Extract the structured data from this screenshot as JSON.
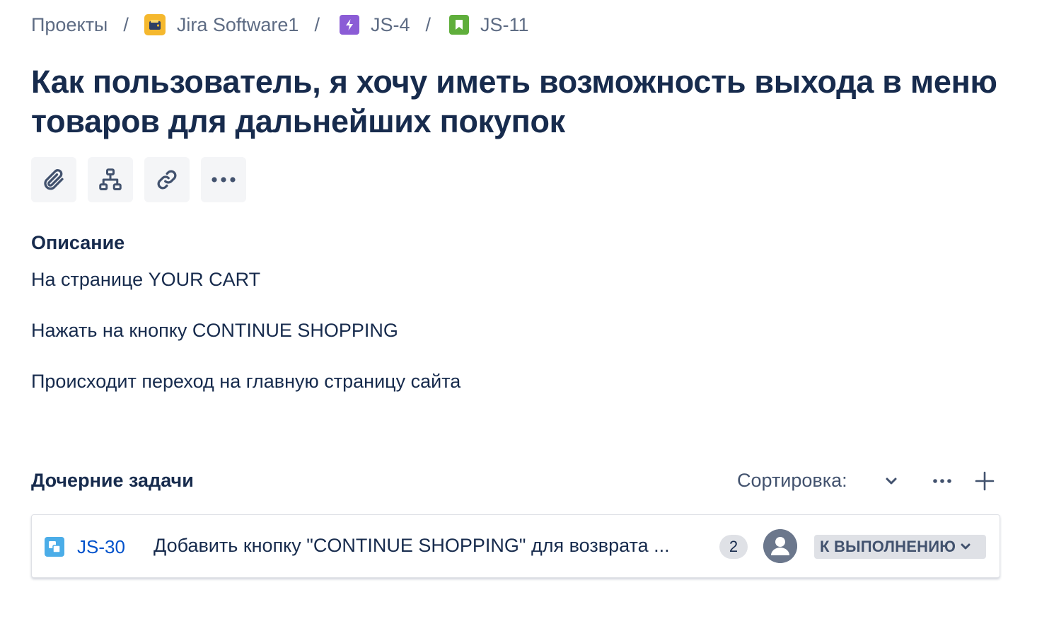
{
  "breadcrumbs": {
    "projects": "Проекты",
    "project": "Jira Software1",
    "epic": "JS-4",
    "story": "JS-11",
    "separator": "/"
  },
  "issue": {
    "title": "Как пользователь, я хочу иметь возможность выхода в меню товаров для дальнейших покупок"
  },
  "toolbar": {
    "icons": [
      "paperclip-icon",
      "hierarchy-icon",
      "link-icon",
      "more-icon"
    ]
  },
  "description": {
    "heading": "Описание",
    "lines": [
      "На странице YOUR CART",
      "Нажать на кнопку CONTINUE SHOPPING",
      "Происходит переход на главную страницу сайта"
    ]
  },
  "child_issues": {
    "heading": "Дочерние задачи",
    "sort_label": "Сортировка:",
    "items": [
      {
        "key": "JS-30",
        "summary": "Добавить кнопку \"CONTINUE SHOPPING\" для возврата ...",
        "priority": "2",
        "status": "К ВЫПОЛНЕНИЮ"
      }
    ]
  },
  "colors": {
    "text": "#172b4d",
    "link": "#0052cc",
    "project_icon": "#f5b82e",
    "epic_icon": "#8b5cd6",
    "story_icon": "#5fae3b",
    "subtask_icon": "#4bade8"
  }
}
